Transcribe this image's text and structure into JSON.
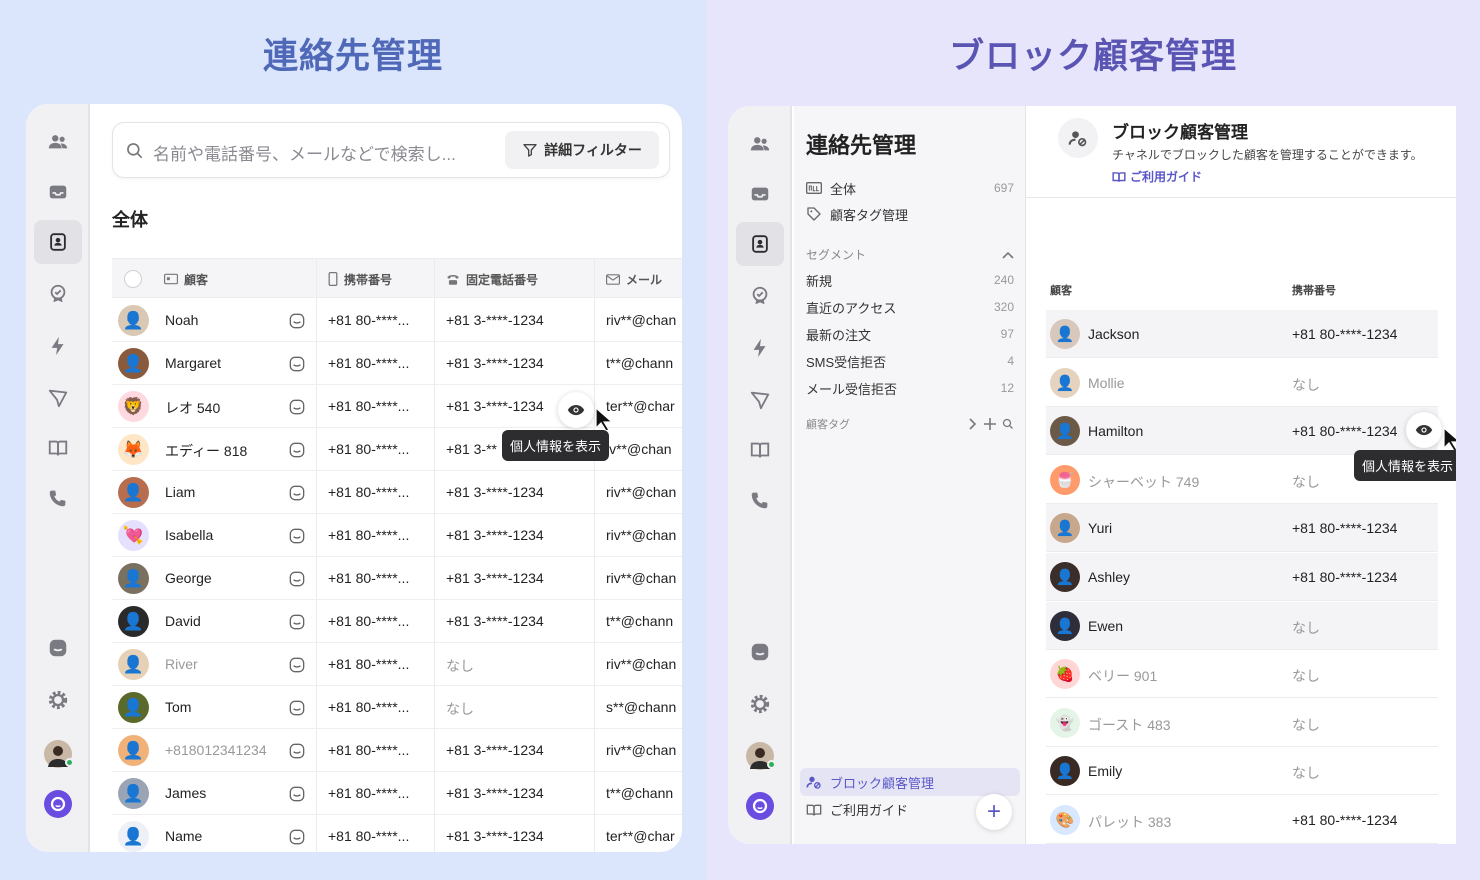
{
  "left": {
    "heading": "連絡先管理",
    "search_placeholder": "名前や電話番号、メールなどで検索し...",
    "filter_button": "詳細フィルター",
    "section_title": "全体",
    "columns": {
      "customer": "顧客",
      "mobile": "携帯番号",
      "landline": "固定電話番号",
      "email": "メール"
    },
    "rows": [
      {
        "name": "Noah",
        "mobile": "+81 80-****...",
        "landline": "+81 3-****-1234",
        "email": "riv**@chan",
        "avatar": "person-photo"
      },
      {
        "name": "Margaret",
        "mobile": "+81 80-****...",
        "landline": "+81 3-****-1234",
        "email": "t**@chann",
        "avatar": "person-photo"
      },
      {
        "name": "レオ 540",
        "mobile": "+81 80-****...",
        "landline": "+81 3-****-1234",
        "email": "ter**@char",
        "avatar": "lion-emoji"
      },
      {
        "name": "エディー 818",
        "mobile": "+81 80-****...",
        "landline": "+81 3-**",
        "email": "iv**@chan",
        "avatar": "fox-emoji"
      },
      {
        "name": "Liam",
        "mobile": "+81 80-****...",
        "landline": "+81 3-****-1234",
        "email": "riv**@chan",
        "avatar": "person-photo"
      },
      {
        "name": "Isabella",
        "mobile": "+81 80-****...",
        "landline": "+81 3-****-1234",
        "email": "riv**@chan",
        "avatar": "heart-emoji"
      },
      {
        "name": "George",
        "mobile": "+81 80-****...",
        "landline": "+81 3-****-1234",
        "email": "riv**@chan",
        "avatar": "person-photo"
      },
      {
        "name": "David",
        "mobile": "+81 80-****...",
        "landline": "+81 3-****-1234",
        "email": "t**@chann",
        "avatar": "person-photo"
      },
      {
        "name": "River",
        "mobile": "+81 80-****...",
        "landline": "なし",
        "email": "riv**@chan",
        "avatar": "person-photo"
      },
      {
        "name": "Tom",
        "mobile": "+81 80-****...",
        "landline": "なし",
        "email": "s**@chann",
        "avatar": "person-photo"
      },
      {
        "name": "+818012341234",
        "mobile": "+81 80-****...",
        "landline": "+81 3-****-1234",
        "email": "riv**@chan",
        "avatar": "person-photo"
      },
      {
        "name": "James",
        "mobile": "+81 80-****...",
        "landline": "+81 3-****-1234",
        "email": "t**@chann",
        "avatar": "person-photo"
      },
      {
        "name": "Name",
        "mobile": "+81 80-****...",
        "landline": "+81 3-****-1234",
        "email": "ter**@char",
        "avatar": "default-person"
      }
    ],
    "tooltip": "個人情報を表示"
  },
  "right": {
    "heading": "ブロック顧客管理",
    "sub_title": "連絡先管理",
    "nav": [
      {
        "label": "全体",
        "count": "697"
      },
      {
        "label": "顧客タグ管理",
        "count": ""
      }
    ],
    "segment_header": "セグメント",
    "segments": [
      {
        "label": "新規",
        "count": "240"
      },
      {
        "label": "直近のアクセス",
        "count": "320"
      },
      {
        "label": "最新の注文",
        "count": "97"
      },
      {
        "label": "SMS受信拒否",
        "count": "4"
      },
      {
        "label": "メール受信拒否",
        "count": "12"
      }
    ],
    "tag_header": "顧客タグ",
    "blocked_item": "ブロック顧客管理",
    "guide_item": "ご利用ガイド",
    "main_title": "ブロック顧客管理",
    "main_desc": "チャネルでブロックした顧客を管理することができます。",
    "main_link": "ご利用ガイド",
    "columns": {
      "customer": "顧客",
      "mobile": "携帯番号"
    },
    "rows": [
      {
        "name": "Jackson",
        "mobile": "+81 80-****-1234"
      },
      {
        "name": "Mollie",
        "mobile": "なし"
      },
      {
        "name": "Hamilton",
        "mobile": "+81 80-****-1234"
      },
      {
        "name": "シャーベット 749",
        "mobile": "なし"
      },
      {
        "name": "Yuri",
        "mobile": "+81 80-****-1234"
      },
      {
        "name": "Ashley",
        "mobile": "+81 80-****-1234"
      },
      {
        "name": "Ewen",
        "mobile": "なし"
      },
      {
        "name": "ベリー 901",
        "mobile": "なし"
      },
      {
        "name": "ゴースト 483",
        "mobile": "なし"
      },
      {
        "name": "Emily",
        "mobile": "なし"
      },
      {
        "name": "パレット 383",
        "mobile": "+81 80-****-1234"
      }
    ],
    "tooltip": "個人情報を表示"
  }
}
